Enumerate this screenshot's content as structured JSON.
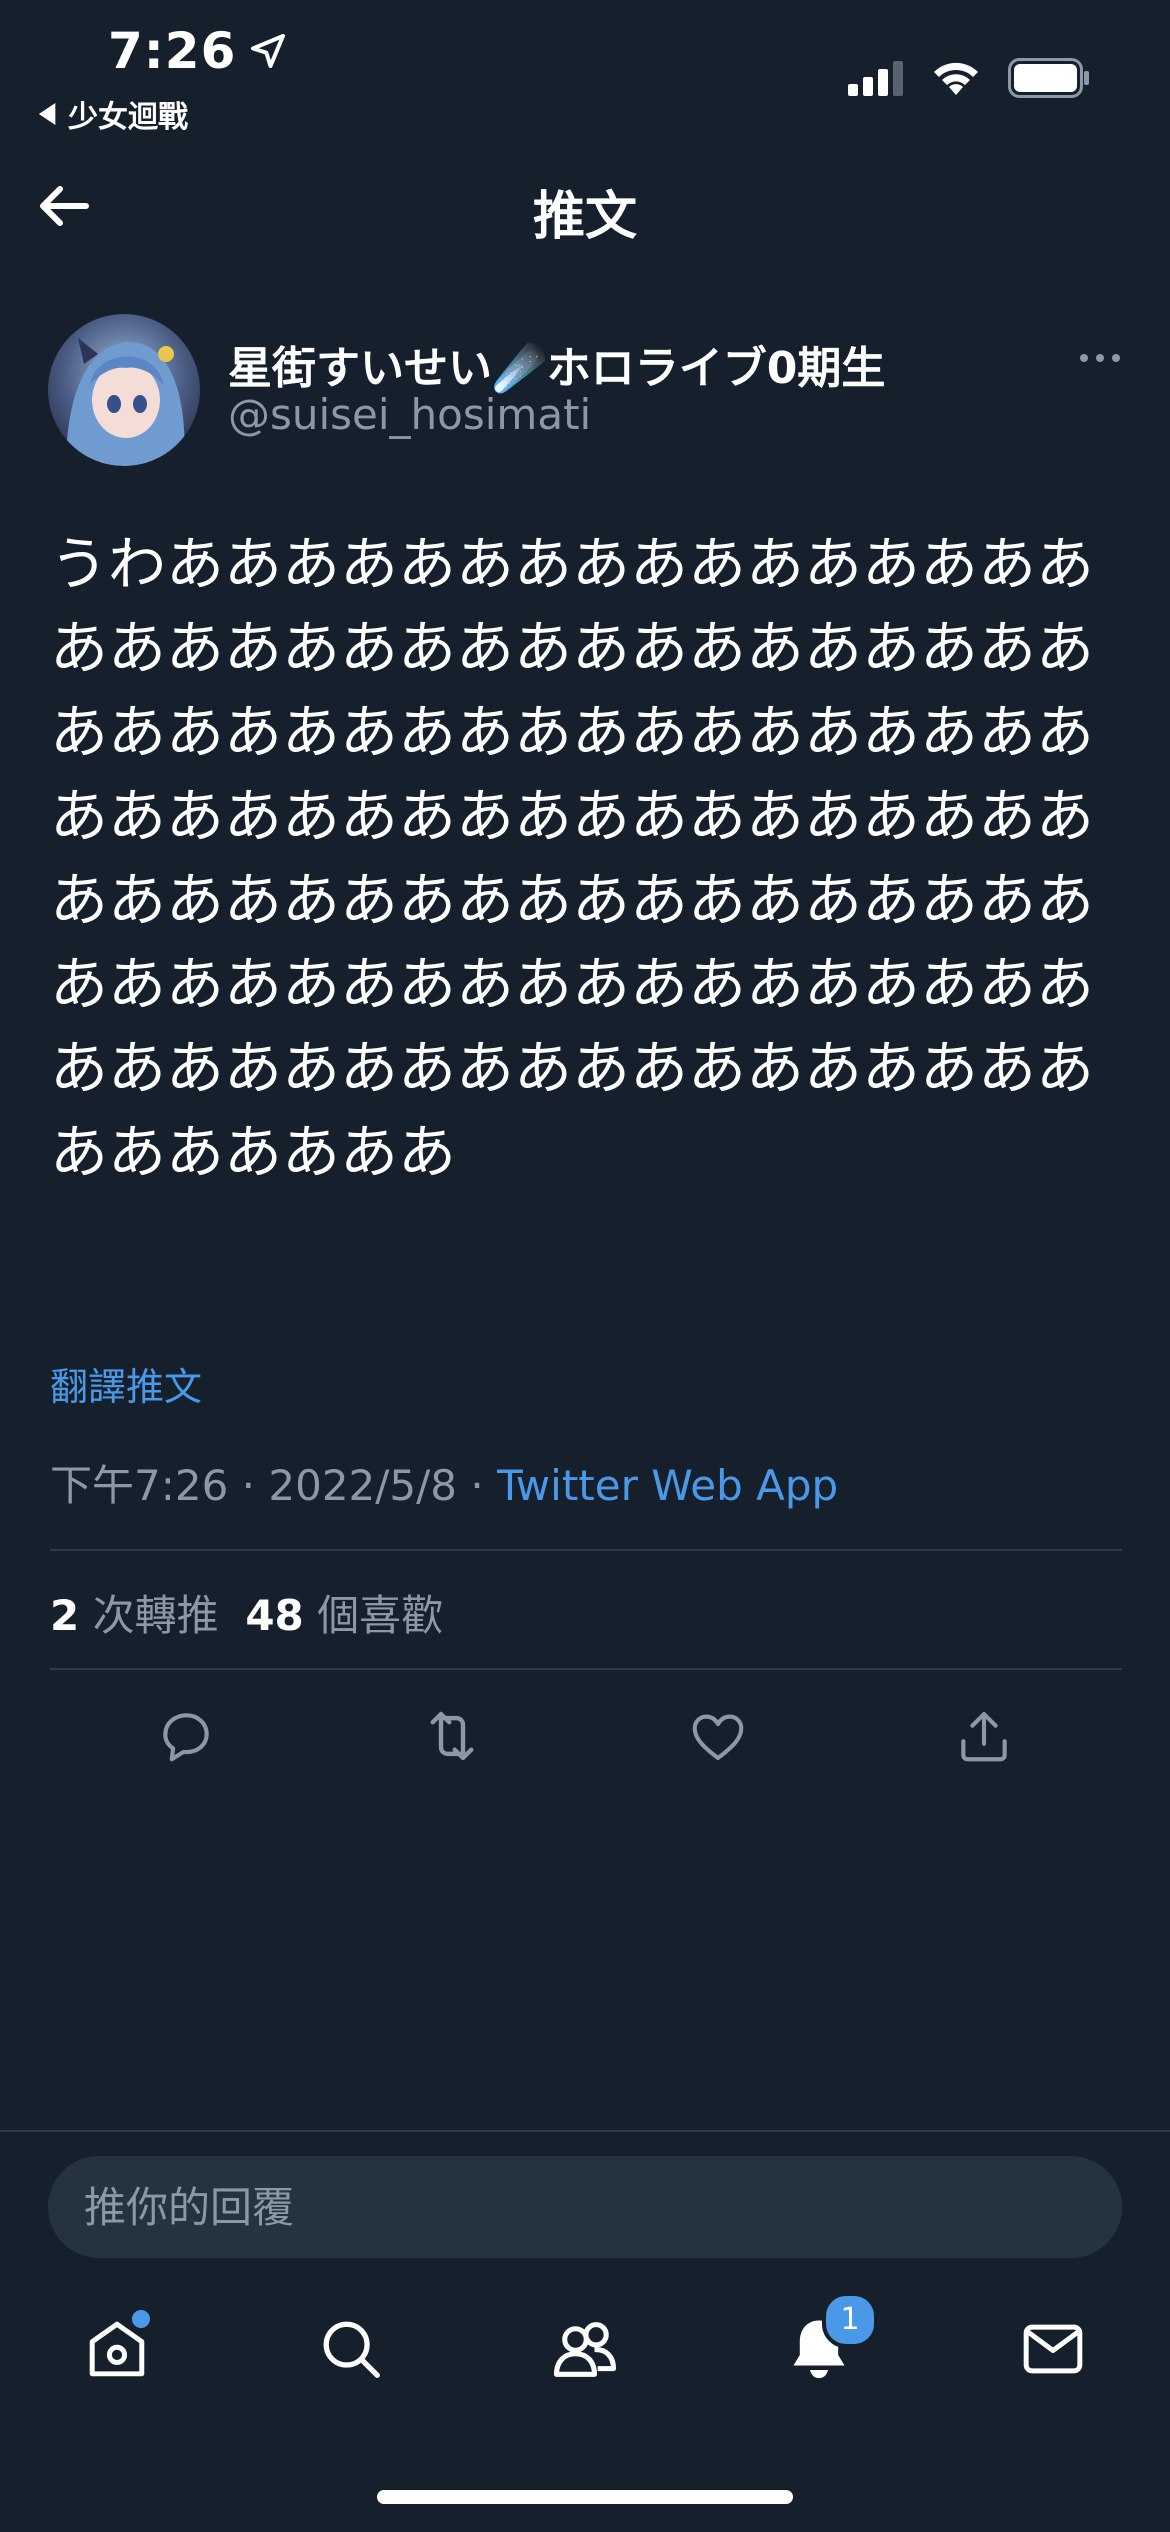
{
  "status_bar": {
    "time": "7:26",
    "back_app": "少女迴戰"
  },
  "header": {
    "title": "推文"
  },
  "author": {
    "display_name": "星街すいせい☄️ホロライブ0期生",
    "handle": "@suisei_hosimati"
  },
  "tweet": {
    "text": "うわあああああああああああああああああああああああああああああああああああああああああああああああああああああああああああああああああああああああああああああああああああああああああああああああああああああああああああああああああああああああああああああああああああ",
    "translate_label": "翻譯推文",
    "time": "下午7:26",
    "date": "2022/5/8",
    "separator": " · ",
    "source": "Twitter Web App"
  },
  "stats": {
    "retweets_count": "2",
    "retweets_label": "次轉推",
    "likes_count": "48",
    "likes_label": "個喜歡"
  },
  "actions": {
    "reply_icon": "reply-icon",
    "retweet_icon": "retweet-icon",
    "like_icon": "heart-icon",
    "share_icon": "share-icon"
  },
  "reply": {
    "placeholder": "推你的回覆"
  },
  "tabbar": {
    "notifications_badge": "1"
  },
  "colors": {
    "background": "#16202c",
    "accent": "#4a99e9",
    "secondary_text": "#8b98a5",
    "divider": "#2f3b48"
  }
}
